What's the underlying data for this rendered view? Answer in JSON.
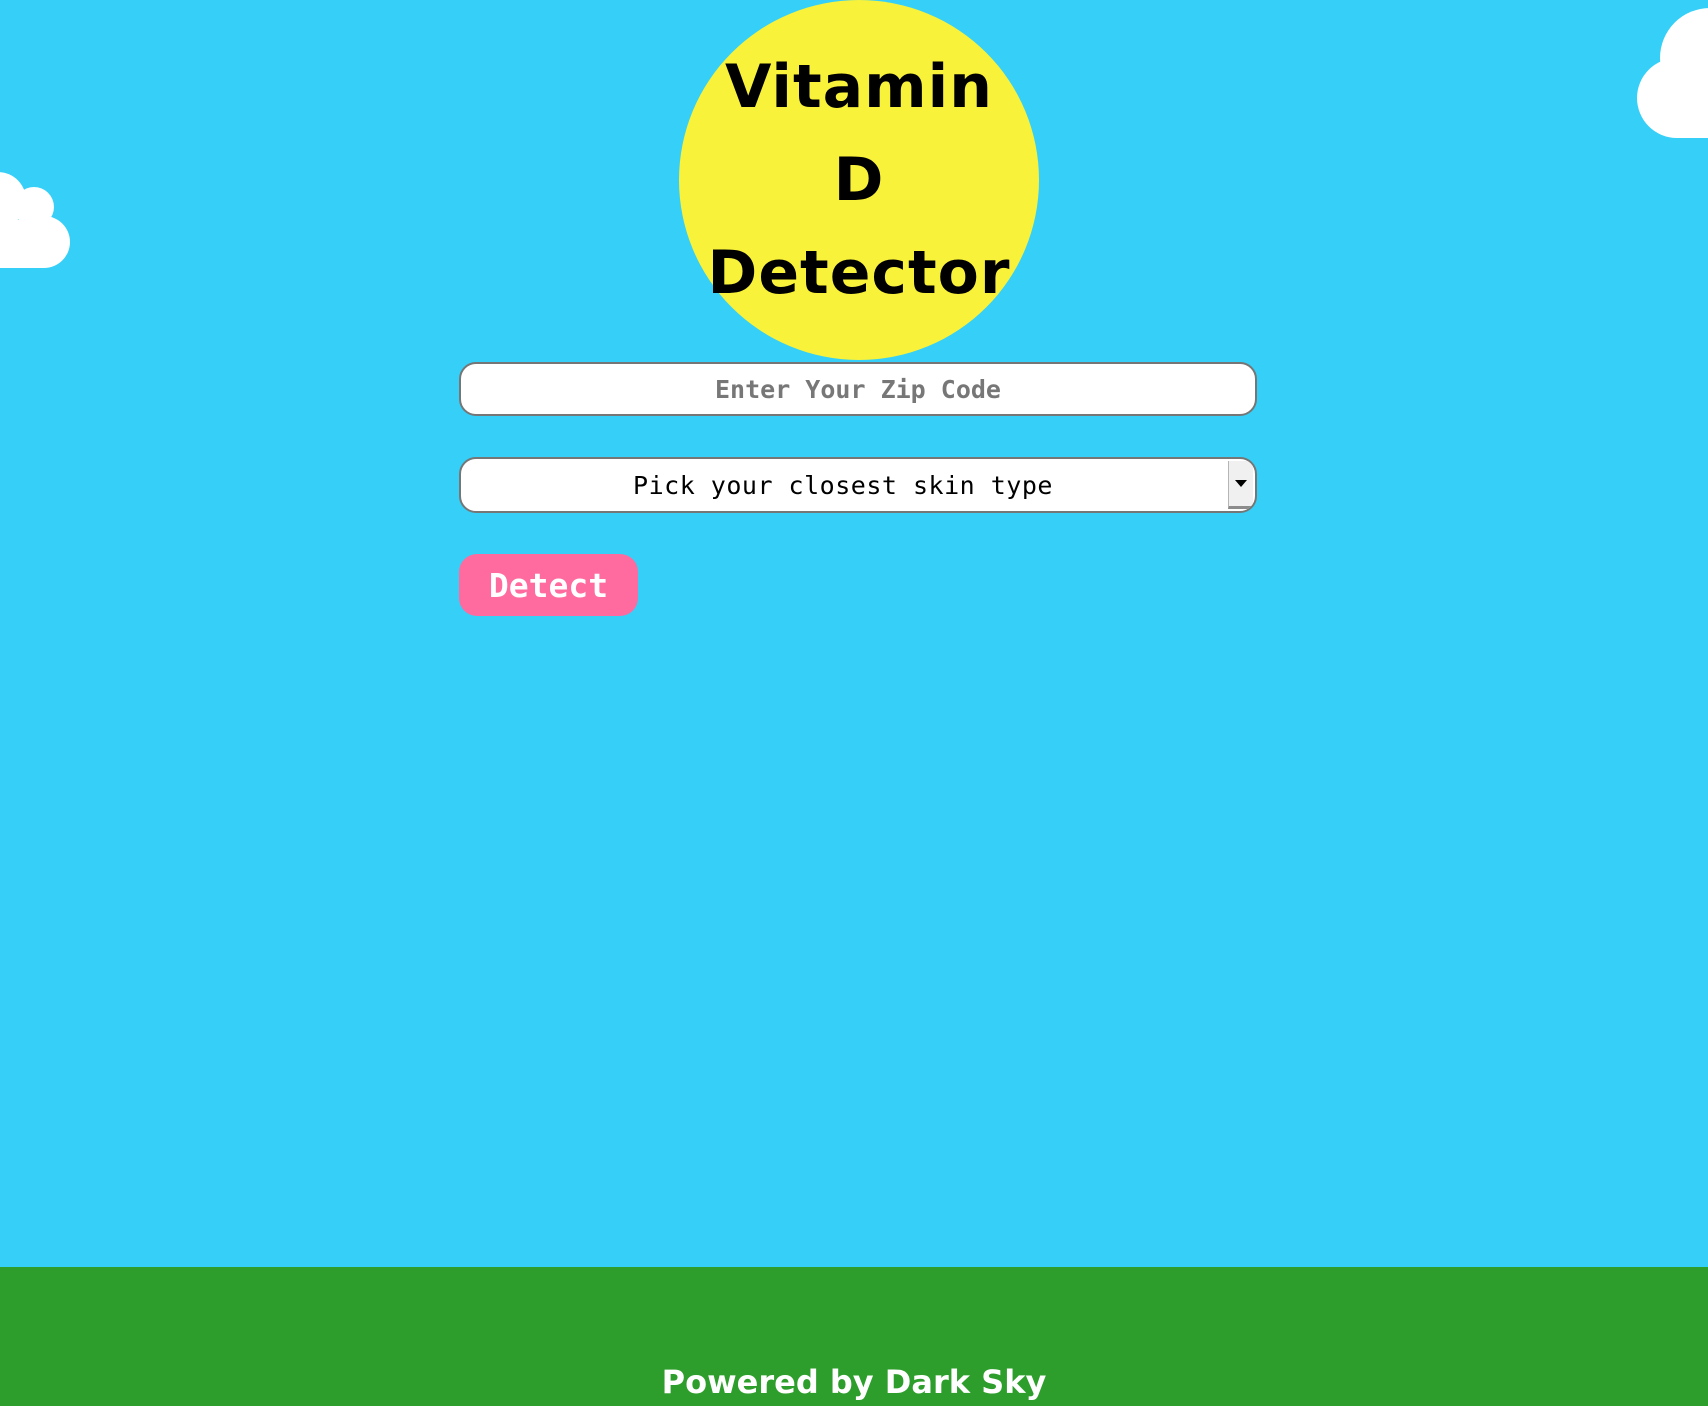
{
  "header": {
    "title_line1": "Vitamin D",
    "title_line2": "Detector"
  },
  "form": {
    "zip_placeholder": "Enter Your Zip Code",
    "zip_value": "",
    "skin_select_value": "Pick your closest skin type",
    "detect_label": "Detect"
  },
  "footer": {
    "text": "Powered by Dark Sky"
  },
  "colors": {
    "sky": "#35cff7",
    "sun": "#f9f23a",
    "button": "#ff6b9f",
    "ground": "#2d9e2b"
  }
}
